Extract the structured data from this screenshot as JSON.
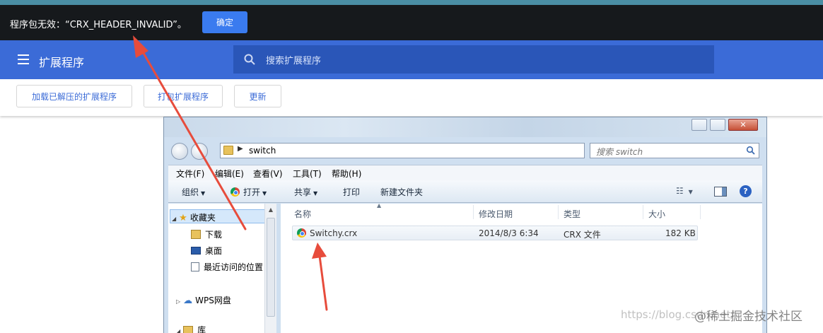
{
  "error_banner": {
    "message": "程序包无效：“CRX_HEADER_INVALID”。",
    "ok_label": "确定"
  },
  "extensions_page": {
    "title": "扩展程序",
    "search_placeholder": "搜索扩展程序",
    "buttons": {
      "load_unpacked": "加载已解压的扩展程序",
      "pack": "打包扩展程序",
      "update": "更新"
    },
    "colors": {
      "header": "#3b6bd7",
      "banner": "#16191c",
      "ok_button": "#3a7bef"
    }
  },
  "explorer": {
    "address": "switch",
    "search_placeholder": "搜索 switch",
    "menu": [
      "文件(F)",
      "编辑(E)",
      "查看(V)",
      "工具(T)",
      "帮助(H)"
    ],
    "commands": {
      "organize": "组织",
      "open": "打开",
      "share": "共享",
      "print": "打印",
      "new_folder": "新建文件夹"
    },
    "nav": {
      "favorites": "收藏夹",
      "downloads": "下载",
      "desktop": "桌面",
      "recent": "最近访问的位置",
      "wps": "WPS网盘",
      "library": "库"
    },
    "columns": [
      "名称",
      "修改日期",
      "类型",
      "大小"
    ],
    "files": [
      {
        "name": "Switchy.crx",
        "modified": "2014/8/3 6:34",
        "type": "CRX 文件",
        "size": "182 KB"
      }
    ]
  },
  "watermark": {
    "url": "https://blog.csdn.net/",
    "brand": "@稀土掘金技术社区"
  },
  "annotation_color": "#e74c3c"
}
